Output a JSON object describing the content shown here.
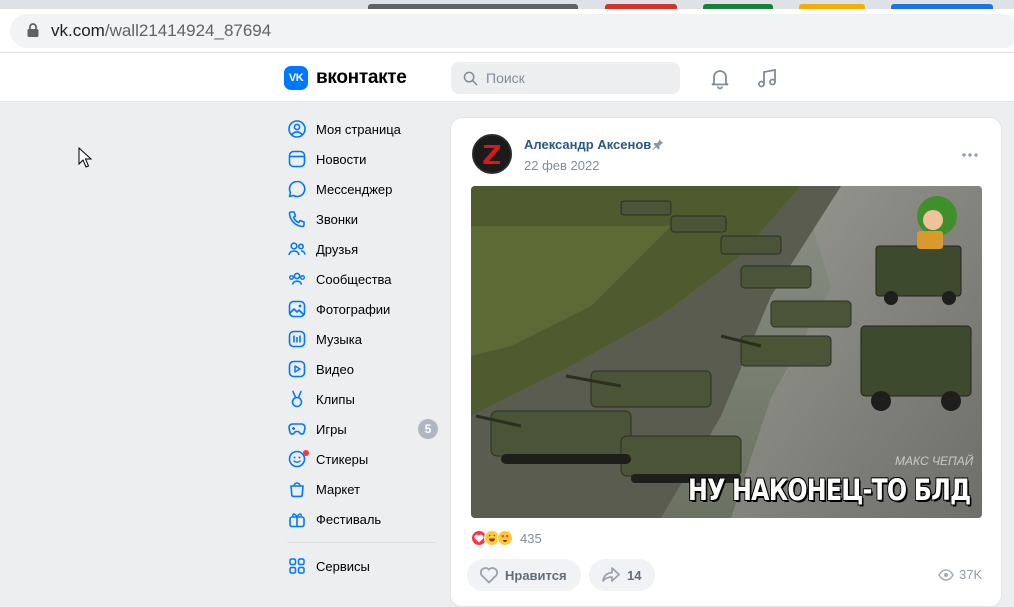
{
  "browser": {
    "url_host": "vk.com",
    "url_path": "/wall21414924_87694"
  },
  "header": {
    "brand": "вконтакте",
    "logo_text": "VK",
    "search_placeholder": "Поиск"
  },
  "menu": {
    "items": [
      {
        "label": "Моя страница",
        "icon": "profile-icon"
      },
      {
        "label": "Новости",
        "icon": "news-icon"
      },
      {
        "label": "Мессенджер",
        "icon": "messenger-icon"
      },
      {
        "label": "Звонки",
        "icon": "phone-icon"
      },
      {
        "label": "Друзья",
        "icon": "friends-icon"
      },
      {
        "label": "Сообщества",
        "icon": "communities-icon"
      },
      {
        "label": "Фотографии",
        "icon": "photos-icon"
      },
      {
        "label": "Музыка",
        "icon": "music-icon"
      },
      {
        "label": "Видео",
        "icon": "video-icon"
      },
      {
        "label": "Клипы",
        "icon": "clips-icon"
      },
      {
        "label": "Игры",
        "icon": "games-icon",
        "badge": "5"
      },
      {
        "label": "Стикеры",
        "icon": "stickers-icon"
      },
      {
        "label": "Маркет",
        "icon": "market-icon"
      },
      {
        "label": "Фестиваль",
        "icon": "festival-icon"
      }
    ],
    "secondary": [
      {
        "label": "Сервисы",
        "icon": "services-icon"
      }
    ]
  },
  "post": {
    "author": "Александр Аксенов",
    "date": "22 фев 2022",
    "image_caption": "НУ НАКОНЕЦ-ТО БЛД",
    "image_watermark": "МАКС ЧЕПАЙ",
    "reactions_count": "435",
    "like_label": "Нравится",
    "share_count": "14",
    "views": "37K"
  },
  "colors": {
    "vk_blue": "#0077ff",
    "link": "#2a5885",
    "page_bg": "#edeef0"
  }
}
